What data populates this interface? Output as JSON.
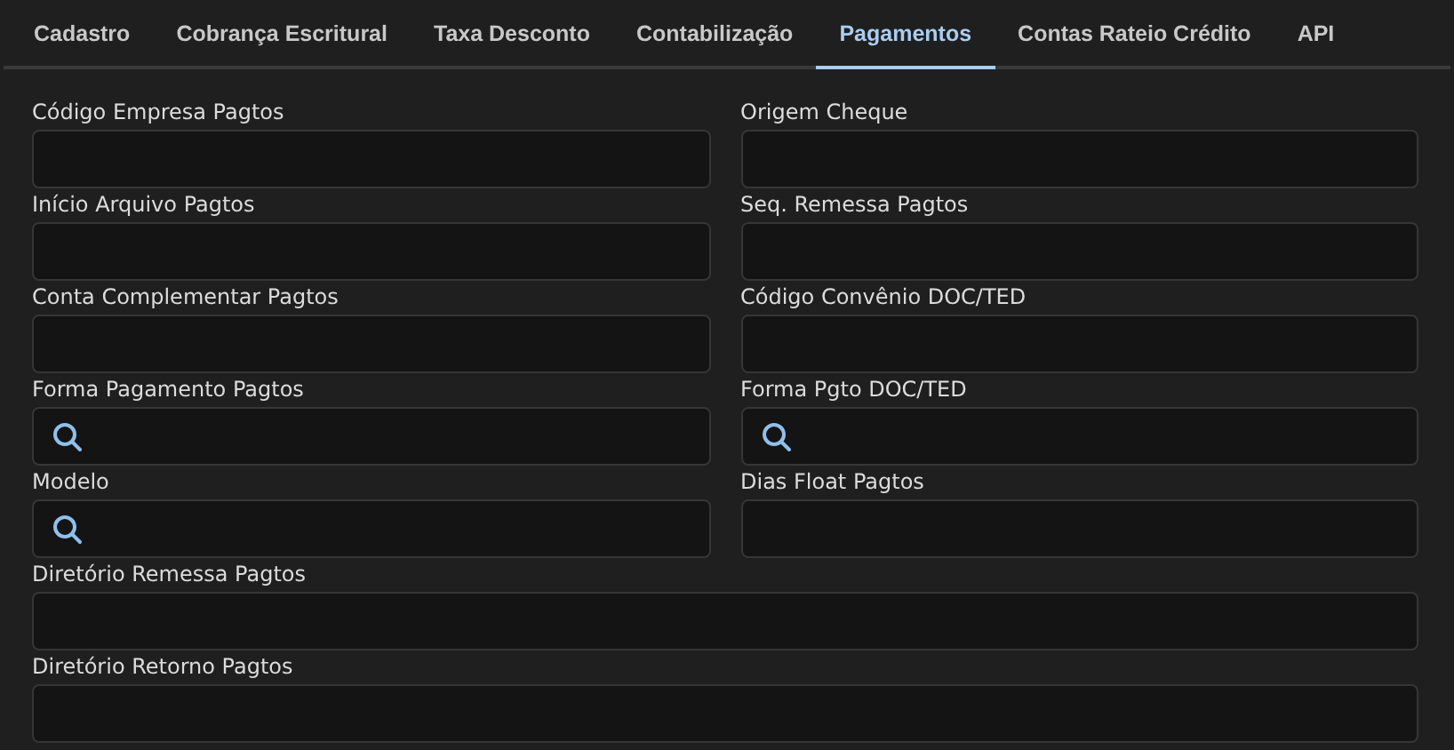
{
  "tabs": [
    {
      "label": "Cadastro",
      "selected": false
    },
    {
      "label": "Cobrança Escritural",
      "selected": false
    },
    {
      "label": "Taxa Desconto",
      "selected": false
    },
    {
      "label": "Contabilização",
      "selected": false
    },
    {
      "label": "Pagamentos",
      "selected": true
    },
    {
      "label": "Contas Rateio Crédito",
      "selected": false
    },
    {
      "label": "API",
      "selected": false
    }
  ],
  "fields": [
    {
      "label": "Código Empresa Pagtos",
      "kind": "text"
    },
    {
      "label": "Origem Cheque",
      "kind": "text"
    },
    {
      "label": "Início Arquivo Pagtos",
      "kind": "text"
    },
    {
      "label": "Seq. Remessa Pagtos",
      "kind": "text"
    },
    {
      "label": "Conta Complementar Pagtos",
      "kind": "text"
    },
    {
      "label": "Código Convênio DOC/TED",
      "kind": "text"
    },
    {
      "label": "Forma Pagamento Pagtos",
      "kind": "lookup"
    },
    {
      "label": "Forma Pgto DOC/TED",
      "kind": "lookup"
    },
    {
      "label": "Modelo",
      "kind": "lookup"
    },
    {
      "label": "Dias Float Pagtos",
      "kind": "text"
    }
  ],
  "wide_fields": [
    {
      "label": "Diretório Remessa Pagtos"
    },
    {
      "label": "Diretório Retorno Pagtos"
    }
  ]
}
